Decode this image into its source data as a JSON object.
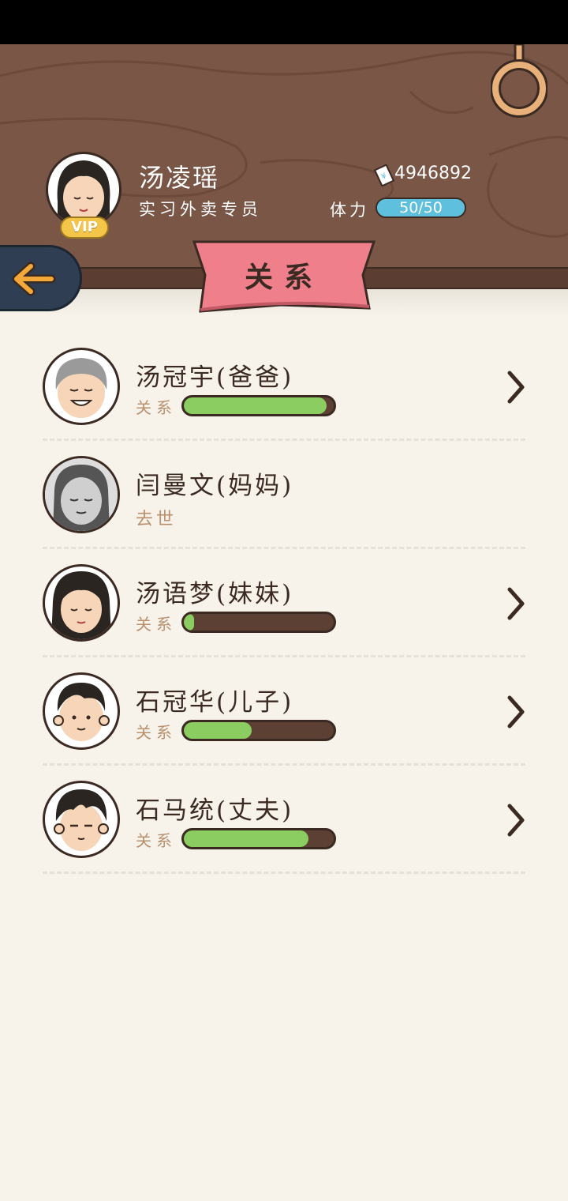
{
  "player": {
    "name": "汤凌瑶",
    "title": "实习外卖专员",
    "vip_label": "VIP",
    "coins": "4946892",
    "stamina_label": "体力",
    "stamina_text": "50/50",
    "stamina_fraction": 1.0
  },
  "page_title": "关系",
  "relationship_label": "关系",
  "relatives": [
    {
      "name": "汤冠宇(爸爸)",
      "relation_level": 0.95,
      "deceased": false,
      "status": ""
    },
    {
      "name": "闫曼文(妈妈)",
      "relation_level": null,
      "deceased": true,
      "status": "去世"
    },
    {
      "name": "汤语梦(妹妹)",
      "relation_level": 0.07,
      "deceased": false,
      "status": ""
    },
    {
      "name": "石冠华(儿子)",
      "relation_level": 0.45,
      "deceased": false,
      "status": ""
    },
    {
      "name": "石马统(丈夫)",
      "relation_level": 0.83,
      "deceased": false,
      "status": ""
    }
  ],
  "colors": {
    "wood": "#7a5646",
    "banner": "#f07f8c",
    "relation_fill": "#8ccd62",
    "stamina": "#5ec0dc",
    "back_button": "#2f3e52",
    "arrow": "#f3a93a"
  },
  "icons": {
    "back": "arrow-left-icon",
    "ring": "ring-icon",
    "coin": "ticket-icon",
    "chevron": "chevron-right-icon"
  }
}
